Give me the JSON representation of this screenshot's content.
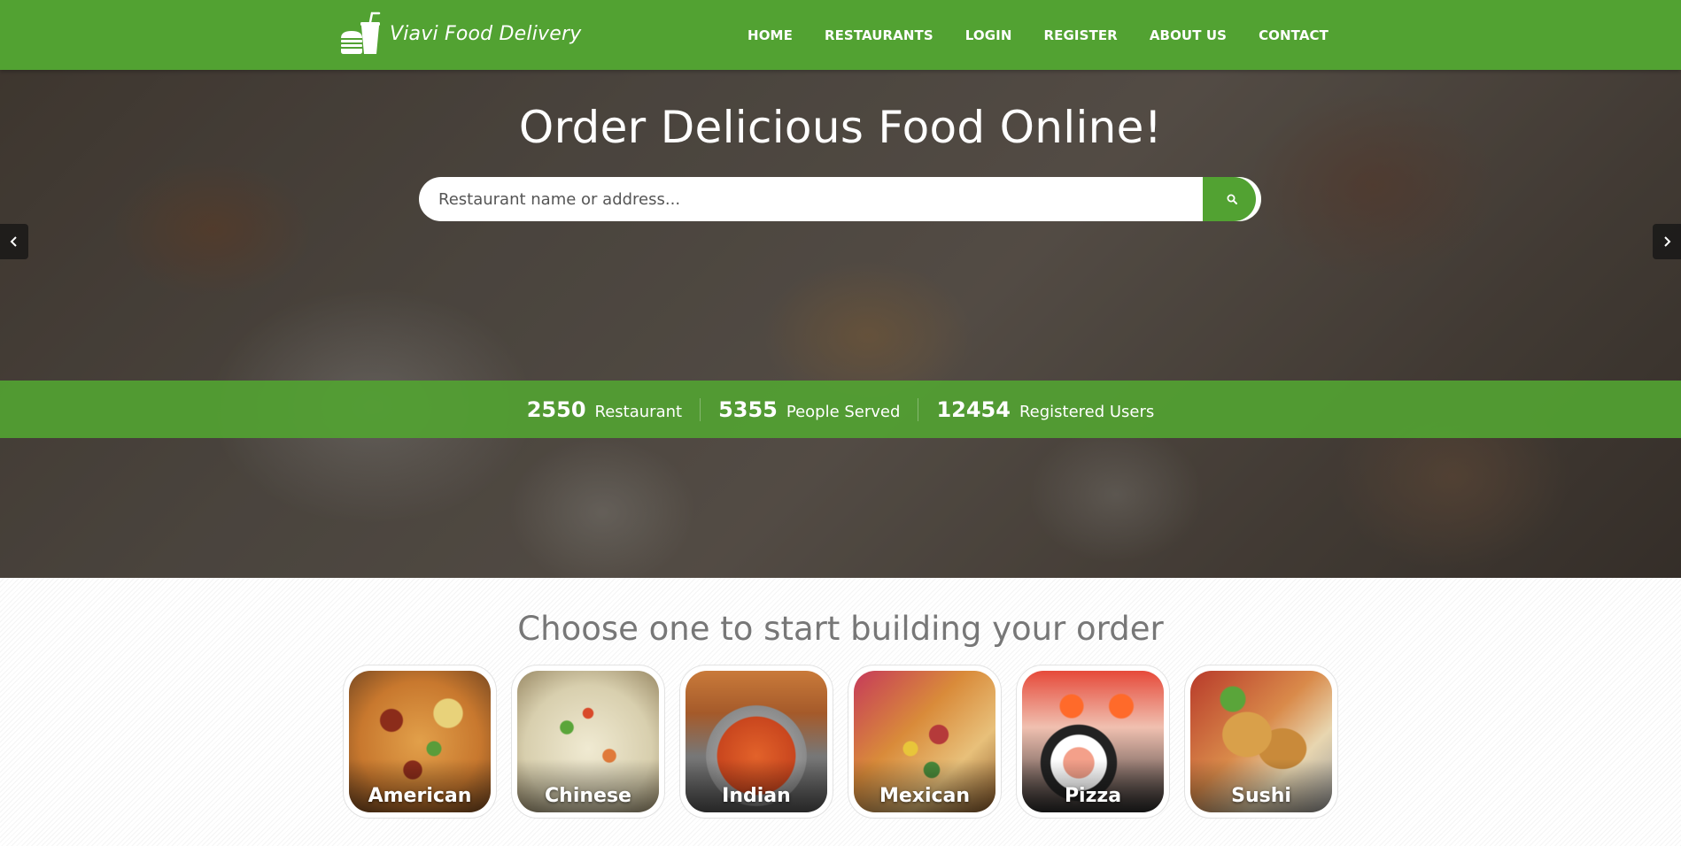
{
  "header": {
    "brand": "Viavi Food Delivery",
    "nav": [
      "HOME",
      "RESTAURANTS",
      "LOGIN",
      "REGISTER",
      "ABOUT US",
      "CONTACT"
    ]
  },
  "hero": {
    "title": "Order Delicious Food Online!",
    "search": {
      "placeholder": "Restaurant name or address..."
    }
  },
  "stats": [
    {
      "value": "2550",
      "label": "Restaurant"
    },
    {
      "value": "5355",
      "label": "People Served"
    },
    {
      "value": "12454",
      "label": "Registered Users"
    }
  ],
  "categories": {
    "title": "Choose one to start building your order",
    "items": [
      "American",
      "Chinese",
      "Indian",
      "Mexican",
      "Pizza",
      "Sushi"
    ]
  },
  "colors": {
    "brand_green": "#52a232",
    "heading_gray": "#777777"
  },
  "icons": {
    "logo": "food-delivery-logo-icon",
    "search": "search-icon",
    "prev": "chevron-left-icon",
    "next": "chevron-right-icon"
  }
}
